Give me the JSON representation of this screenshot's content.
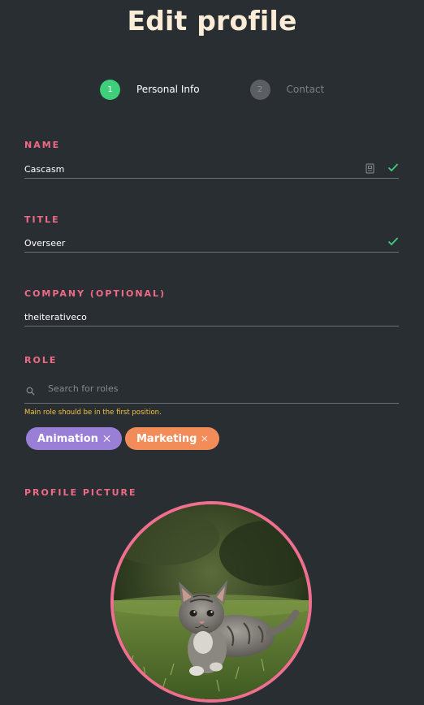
{
  "header": {
    "title": "Edit profile"
  },
  "stepper": {
    "steps": [
      {
        "number": "1",
        "label": "Personal Info"
      },
      {
        "number": "2",
        "label": "Contact"
      }
    ]
  },
  "form": {
    "name": {
      "label": "NAME",
      "value": "Cascasm"
    },
    "title": {
      "label": "TITLE",
      "value": "Overseer"
    },
    "company": {
      "label": "COMPANY (OPTIONAL)",
      "value": "theiterativeco"
    },
    "role": {
      "label": "ROLE",
      "search_placeholder": "Search for roles",
      "hint": "Main role should be in the first position.",
      "tags": [
        {
          "label": "Animation",
          "color": "#9a7fd7"
        },
        {
          "label": "Marketing",
          "color": "#f28d5a"
        }
      ]
    },
    "profile_picture": {
      "label": "PROFILE PICTURE"
    }
  },
  "colors": {
    "background": "#292e33",
    "accent_label": "#f06a86",
    "success": "#3ecf7a",
    "hint": "#f5c542",
    "title": "#fbecd8"
  },
  "icons": {
    "check": "check-icon",
    "id_card": "id-card-icon",
    "search": "search-icon",
    "close": "close-icon"
  }
}
